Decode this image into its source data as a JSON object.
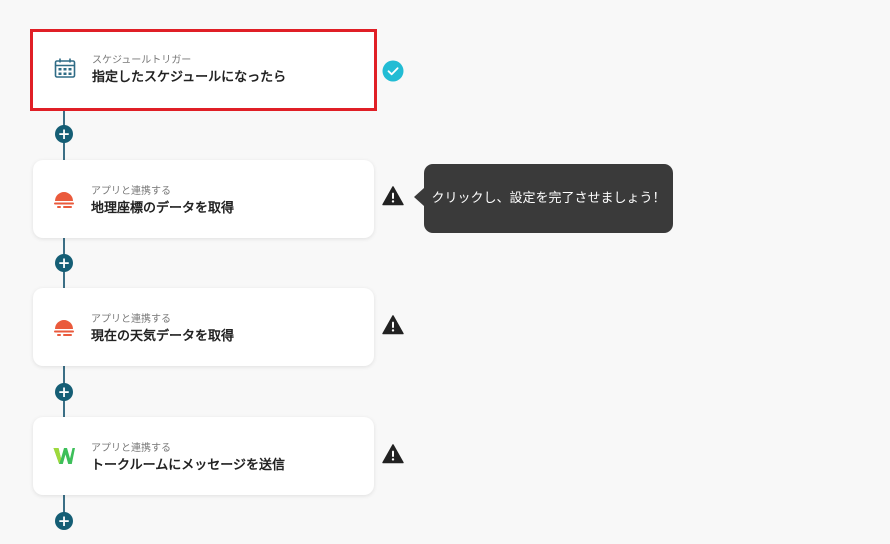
{
  "flow": {
    "steps": [
      {
        "type_label": "スケジュールトリガー",
        "title": "指定したスケジュールになったら",
        "icon": "calendar-clock-icon",
        "status": "complete",
        "selected": true
      },
      {
        "type_label": "アプリと連携する",
        "title": "地理座標のデータを取得",
        "icon": "weather-sun-icon",
        "status": "warning",
        "selected": false
      },
      {
        "type_label": "アプリと連携する",
        "title": "現在の天気データを取得",
        "icon": "weather-sun-icon",
        "status": "warning",
        "selected": false
      },
      {
        "type_label": "アプリと連携する",
        "title": "トークルームにメッセージを送信",
        "icon": "w-logo-icon",
        "status": "warning",
        "selected": false
      }
    ],
    "add_button_label": "+"
  },
  "tooltip": {
    "text": "クリックし、設定を完了させましょう！"
  },
  "colors": {
    "selected_border": "#e01f26",
    "check_circle": "#22bcd4",
    "warning": "#222222",
    "add_button": "#155e75",
    "connector": "#3b6f86",
    "weather_icon": "#ea5a3c",
    "tooltip_bg": "#3a3a3a"
  }
}
